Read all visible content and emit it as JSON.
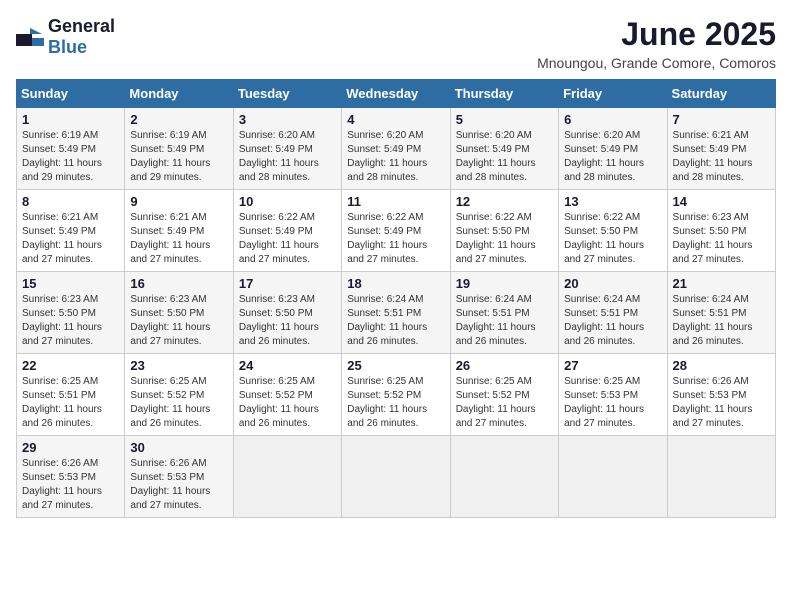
{
  "logo": {
    "general": "General",
    "blue": "Blue"
  },
  "title": "June 2025",
  "location": "Mnoungou, Grande Comore, Comoros",
  "weekdays": [
    "Sunday",
    "Monday",
    "Tuesday",
    "Wednesday",
    "Thursday",
    "Friday",
    "Saturday"
  ],
  "weeks": [
    [
      {
        "day": "1",
        "sunrise": "6:19 AM",
        "sunset": "5:49 PM",
        "daylight": "11 hours and 29 minutes."
      },
      {
        "day": "2",
        "sunrise": "6:19 AM",
        "sunset": "5:49 PM",
        "daylight": "11 hours and 29 minutes."
      },
      {
        "day": "3",
        "sunrise": "6:20 AM",
        "sunset": "5:49 PM",
        "daylight": "11 hours and 28 minutes."
      },
      {
        "day": "4",
        "sunrise": "6:20 AM",
        "sunset": "5:49 PM",
        "daylight": "11 hours and 28 minutes."
      },
      {
        "day": "5",
        "sunrise": "6:20 AM",
        "sunset": "5:49 PM",
        "daylight": "11 hours and 28 minutes."
      },
      {
        "day": "6",
        "sunrise": "6:20 AM",
        "sunset": "5:49 PM",
        "daylight": "11 hours and 28 minutes."
      },
      {
        "day": "7",
        "sunrise": "6:21 AM",
        "sunset": "5:49 PM",
        "daylight": "11 hours and 28 minutes."
      }
    ],
    [
      {
        "day": "8",
        "sunrise": "6:21 AM",
        "sunset": "5:49 PM",
        "daylight": "11 hours and 27 minutes."
      },
      {
        "day": "9",
        "sunrise": "6:21 AM",
        "sunset": "5:49 PM",
        "daylight": "11 hours and 27 minutes."
      },
      {
        "day": "10",
        "sunrise": "6:22 AM",
        "sunset": "5:49 PM",
        "daylight": "11 hours and 27 minutes."
      },
      {
        "day": "11",
        "sunrise": "6:22 AM",
        "sunset": "5:49 PM",
        "daylight": "11 hours and 27 minutes."
      },
      {
        "day": "12",
        "sunrise": "6:22 AM",
        "sunset": "5:50 PM",
        "daylight": "11 hours and 27 minutes."
      },
      {
        "day": "13",
        "sunrise": "6:22 AM",
        "sunset": "5:50 PM",
        "daylight": "11 hours and 27 minutes."
      },
      {
        "day": "14",
        "sunrise": "6:23 AM",
        "sunset": "5:50 PM",
        "daylight": "11 hours and 27 minutes."
      }
    ],
    [
      {
        "day": "15",
        "sunrise": "6:23 AM",
        "sunset": "5:50 PM",
        "daylight": "11 hours and 27 minutes."
      },
      {
        "day": "16",
        "sunrise": "6:23 AM",
        "sunset": "5:50 PM",
        "daylight": "11 hours and 27 minutes."
      },
      {
        "day": "17",
        "sunrise": "6:23 AM",
        "sunset": "5:50 PM",
        "daylight": "11 hours and 26 minutes."
      },
      {
        "day": "18",
        "sunrise": "6:24 AM",
        "sunset": "5:51 PM",
        "daylight": "11 hours and 26 minutes."
      },
      {
        "day": "19",
        "sunrise": "6:24 AM",
        "sunset": "5:51 PM",
        "daylight": "11 hours and 26 minutes."
      },
      {
        "day": "20",
        "sunrise": "6:24 AM",
        "sunset": "5:51 PM",
        "daylight": "11 hours and 26 minutes."
      },
      {
        "day": "21",
        "sunrise": "6:24 AM",
        "sunset": "5:51 PM",
        "daylight": "11 hours and 26 minutes."
      }
    ],
    [
      {
        "day": "22",
        "sunrise": "6:25 AM",
        "sunset": "5:51 PM",
        "daylight": "11 hours and 26 minutes."
      },
      {
        "day": "23",
        "sunrise": "6:25 AM",
        "sunset": "5:52 PM",
        "daylight": "11 hours and 26 minutes."
      },
      {
        "day": "24",
        "sunrise": "6:25 AM",
        "sunset": "5:52 PM",
        "daylight": "11 hours and 26 minutes."
      },
      {
        "day": "25",
        "sunrise": "6:25 AM",
        "sunset": "5:52 PM",
        "daylight": "11 hours and 26 minutes."
      },
      {
        "day": "26",
        "sunrise": "6:25 AM",
        "sunset": "5:52 PM",
        "daylight": "11 hours and 27 minutes."
      },
      {
        "day": "27",
        "sunrise": "6:25 AM",
        "sunset": "5:53 PM",
        "daylight": "11 hours and 27 minutes."
      },
      {
        "day": "28",
        "sunrise": "6:26 AM",
        "sunset": "5:53 PM",
        "daylight": "11 hours and 27 minutes."
      }
    ],
    [
      {
        "day": "29",
        "sunrise": "6:26 AM",
        "sunset": "5:53 PM",
        "daylight": "11 hours and 27 minutes."
      },
      {
        "day": "30",
        "sunrise": "6:26 AM",
        "sunset": "5:53 PM",
        "daylight": "11 hours and 27 minutes."
      },
      null,
      null,
      null,
      null,
      null
    ]
  ],
  "labels": {
    "sunrise": "Sunrise: ",
    "sunset": "Sunset: ",
    "daylight": "Daylight: "
  }
}
